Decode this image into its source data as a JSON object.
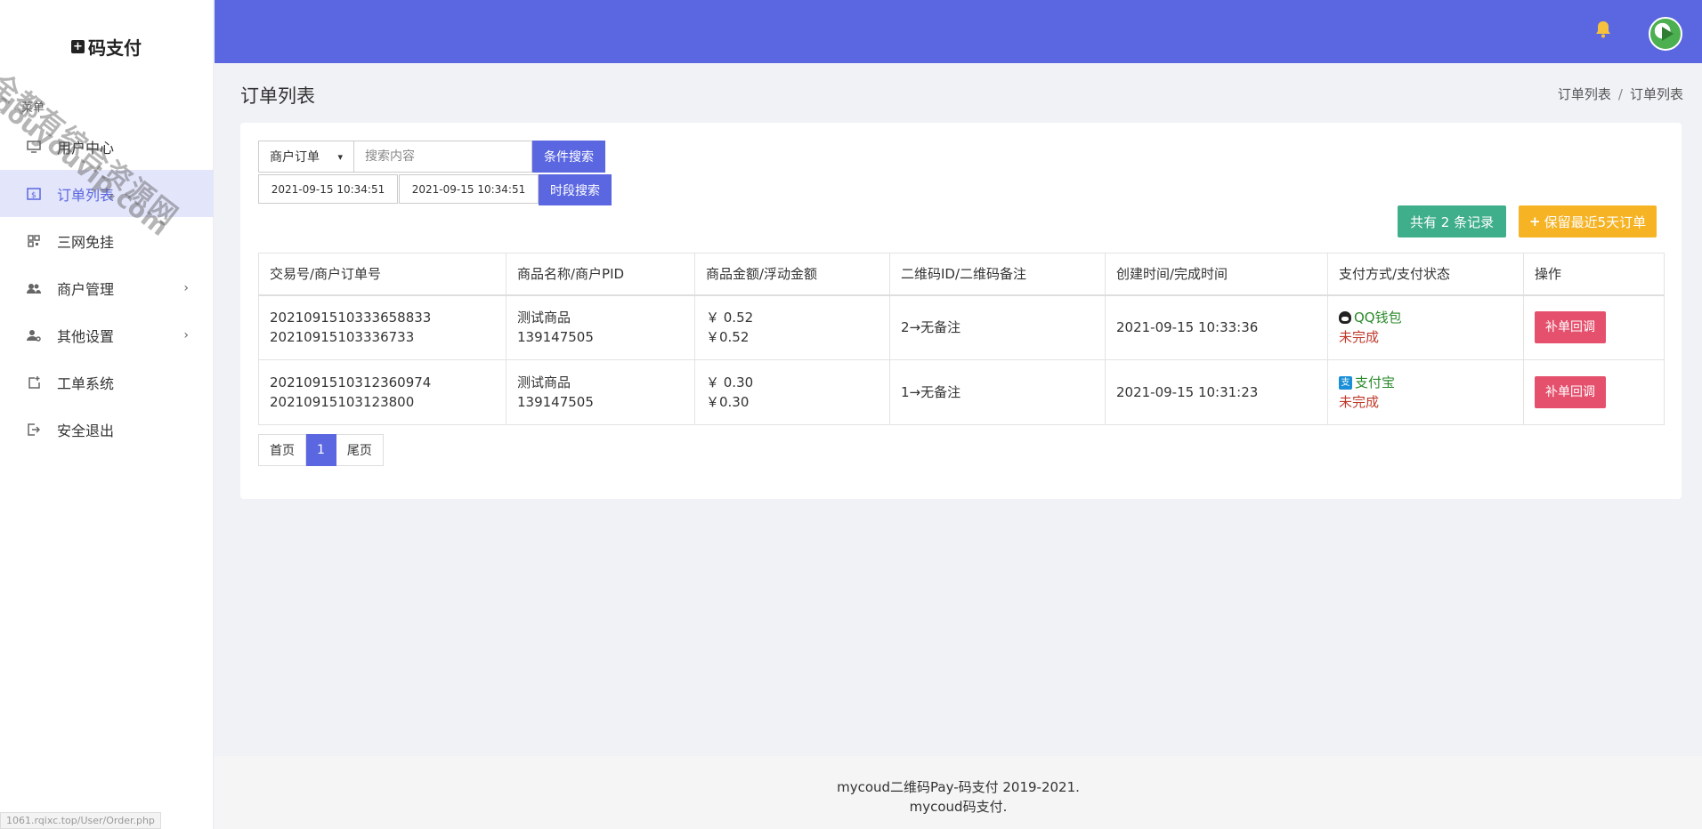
{
  "brand": {
    "name": "码支付"
  },
  "watermark": {
    "line1": "全都有综合资源网",
    "line2": "douyouvip.com"
  },
  "sidebar": {
    "caption": "菜单",
    "items": [
      {
        "label": "用户中心",
        "icon": "monitor-icon"
      },
      {
        "label": "订单列表",
        "icon": "order-icon"
      },
      {
        "label": "三网免挂",
        "icon": "qrcode-icon"
      },
      {
        "label": "商户管理",
        "icon": "users-icon"
      },
      {
        "label": "其他设置",
        "icon": "user-settings-icon"
      },
      {
        "label": "工单系统",
        "icon": "ticket-icon"
      },
      {
        "label": "安全退出",
        "icon": "logout-icon"
      }
    ]
  },
  "status_url": "1061.rqixc.top/User/Order.php",
  "header": {
    "page_title": "订单列表",
    "breadcrumb": [
      "订单列表",
      "订单列表"
    ]
  },
  "filters": {
    "type_select": "商户订单",
    "search_placeholder": "搜索内容",
    "search_button": "条件搜索",
    "start_date": "2021-09-15 10:34:51",
    "end_date": "2021-09-15 10:34:51",
    "date_button": "时段搜索"
  },
  "summary": {
    "count_text": "共有 2 条记录",
    "keep_button": "保留最近5天订单"
  },
  "table": {
    "headers": [
      "交易号/商户订单号",
      "商品名称/商户PID",
      "商品金额/浮动金额",
      "二维码ID/二维码备注",
      "创建时间/完成时间",
      "支付方式/支付状态",
      "操作"
    ],
    "rows": [
      {
        "trade_no": "2021091510333658833",
        "order_no": "20210915103336733",
        "product": "测试商品",
        "pid": "139147505",
        "amount": "￥ 0.52",
        "float_amount": "￥0.52",
        "qrcode": "2→无备注",
        "time": "2021-09-15 10:33:36",
        "pay_method": "QQ钱包",
        "pay_status": "未完成",
        "action": "补单回调"
      },
      {
        "trade_no": "2021091510312360974",
        "order_no": "20210915103123800",
        "product": "测试商品",
        "pid": "139147505",
        "amount": "￥ 0.30",
        "float_amount": "￥0.30",
        "qrcode": "1→无备注",
        "time": "2021-09-15 10:31:23",
        "pay_method": "支付宝",
        "pay_status": "未完成",
        "action": "补单回调"
      }
    ]
  },
  "pagination": {
    "first": "首页",
    "current": "1",
    "last": "尾页"
  },
  "footer": {
    "line1": "mycoud二维码Pay-码支付 2019-2021.",
    "line2": "mycoud码支付."
  },
  "colors": {
    "primary": "#5b67e0",
    "success": "#3fae8a",
    "warning": "#f6b324",
    "danger": "#e5506c"
  }
}
